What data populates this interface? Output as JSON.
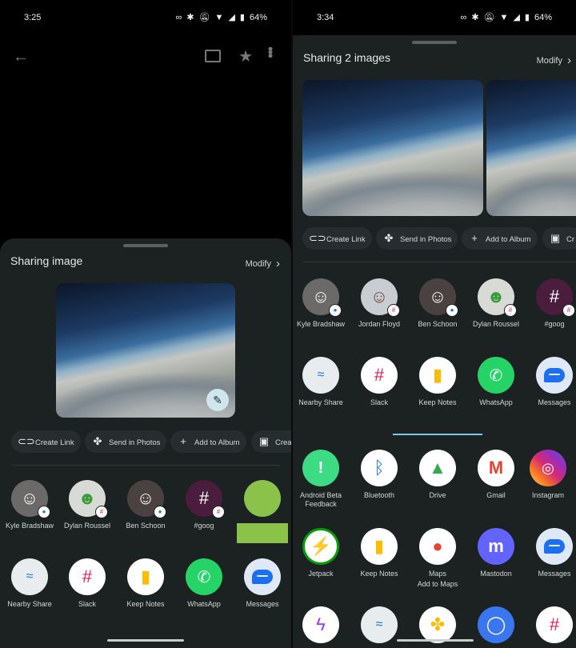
{
  "left": {
    "status": {
      "time": "3:25",
      "battery": "64%"
    },
    "sheet": {
      "title": "Sharing image",
      "modify": "Modify"
    },
    "chips": [
      "Create Link",
      "Send in Photos",
      "Add to Album",
      "Crea"
    ],
    "people": [
      {
        "label": "Kyle Bradshaw",
        "color": "#6b6a68",
        "badge": "msg"
      },
      {
        "label": "Dylan Roussel",
        "color": "#d8dbd5",
        "badge": "slack"
      },
      {
        "label": "Ben Schoon",
        "color": "#4a4240",
        "badge": "msg"
      },
      {
        "label": "#goog",
        "color": "#4a1d3c",
        "badge": "slack"
      }
    ],
    "apps": [
      {
        "label": "Nearby Share",
        "color": "#e8ecef",
        "icon": "nearby-share-icon"
      },
      {
        "label": "Slack",
        "color": "#ffffff",
        "icon": "slack-icon"
      },
      {
        "label": "Keep Notes",
        "color": "#ffffff",
        "icon": "keep-notes-icon"
      },
      {
        "label": "WhatsApp",
        "color": "#25d366",
        "icon": "whatsapp-icon"
      },
      {
        "label": "Messages",
        "color": "#dfe8f6",
        "icon": "messages-icon"
      }
    ]
  },
  "right": {
    "status": {
      "time": "3:34",
      "battery": "64%"
    },
    "sheet": {
      "title": "Sharing 2 images",
      "modify": "Modify"
    },
    "chips": [
      "Create Link",
      "Send in Photos",
      "Add to Album",
      "Cr"
    ],
    "people": [
      {
        "label": "Kyle Bradshaw",
        "color": "#6b6a68",
        "badge": "msg"
      },
      {
        "label": "Jordan Floyd",
        "color": "#c9ccd0",
        "badge": "slack"
      },
      {
        "label": "Ben Schoon",
        "color": "#4a4240",
        "badge": "msg"
      },
      {
        "label": "Dylan Roussel",
        "color": "#d8dbd5",
        "badge": "slack"
      },
      {
        "label": "#goog",
        "color": "#4a1d3c",
        "badge": "slack"
      }
    ],
    "apps_row1": [
      {
        "label": "Nearby Share",
        "color": "#e8ecef",
        "icon": "nearby-share-icon"
      },
      {
        "label": "Slack",
        "color": "#ffffff",
        "icon": "slack-icon"
      },
      {
        "label": "Keep Notes",
        "color": "#ffffff",
        "icon": "keep-notes-icon"
      },
      {
        "label": "WhatsApp",
        "color": "#25d366",
        "icon": "whatsapp-icon"
      },
      {
        "label": "Messages",
        "color": "#dfe8f6",
        "icon": "messages-icon"
      }
    ],
    "apps_row2": [
      {
        "label": "Android Beta Feedback",
        "color": "#3ddc84",
        "icon": "feedback-icon"
      },
      {
        "label": "Bluetooth",
        "color": "#ffffff",
        "icon": "bluetooth-icon"
      },
      {
        "label": "Drive",
        "color": "#ffffff",
        "icon": "drive-icon"
      },
      {
        "label": "Gmail",
        "color": "#ffffff",
        "icon": "gmail-icon"
      },
      {
        "label": "Instagram",
        "color": "#d6249f",
        "icon": "instagram-icon"
      }
    ],
    "apps_row3": [
      {
        "label": "Jetpack",
        "color": "#ffffff",
        "icon": "jetpack-icon"
      },
      {
        "label": "Keep Notes",
        "color": "#ffffff",
        "icon": "keep-notes-icon"
      },
      {
        "label": "Maps",
        "sublabel": "Add to Maps",
        "color": "#ffffff",
        "icon": "maps-icon"
      },
      {
        "label": "Mastodon",
        "color": "#6364ff",
        "icon": "mastodon-icon"
      },
      {
        "label": "Messages",
        "color": "#dfe8f6",
        "icon": "messages-icon"
      }
    ]
  },
  "colors": {
    "sheet": "#1c2122",
    "chip": "#272d2e",
    "accent": "#7fc6e8"
  }
}
